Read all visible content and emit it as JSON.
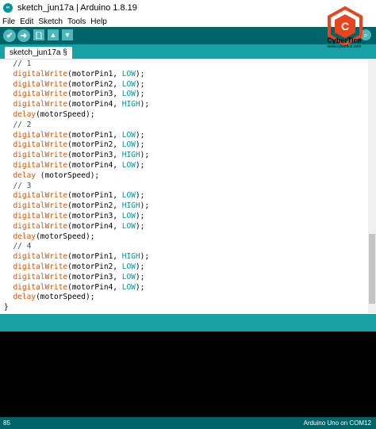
{
  "window": {
    "title": "sketch_jun17a | Arduino 1.8.19"
  },
  "menu": {
    "items": [
      "File",
      "Edit",
      "Sketch",
      "Tools",
      "Help"
    ]
  },
  "toolbar": {
    "buttons": [
      {
        "name": "verify",
        "icon": "check-icon"
      },
      {
        "name": "upload",
        "icon": "arrow-right-icon"
      },
      {
        "name": "new",
        "icon": "file-icon"
      },
      {
        "name": "open",
        "icon": "arrow-up-icon"
      },
      {
        "name": "save",
        "icon": "arrow-down-icon"
      }
    ],
    "serial_monitor_icon": "magnifier-icon"
  },
  "tabs": [
    {
      "label": "sketch_jun17a §"
    }
  ],
  "editor": {
    "lines": [
      {
        "indent": "  ",
        "parts": [
          {
            "t": "// 1",
            "c": "comment"
          }
        ]
      },
      {
        "indent": "  ",
        "parts": [
          {
            "t": "digitalWrite",
            "c": "fn"
          },
          {
            "t": "(motorPin1, ",
            "c": "plain"
          },
          {
            "t": "LOW",
            "c": "const"
          },
          {
            "t": ");",
            "c": "plain"
          }
        ]
      },
      {
        "indent": "  ",
        "parts": [
          {
            "t": "digitalWrite",
            "c": "fn"
          },
          {
            "t": "(motorPin2, ",
            "c": "plain"
          },
          {
            "t": "LOW",
            "c": "const"
          },
          {
            "t": ");",
            "c": "plain"
          }
        ]
      },
      {
        "indent": "  ",
        "parts": [
          {
            "t": "digitalWrite",
            "c": "fn"
          },
          {
            "t": "(motorPin3, ",
            "c": "plain"
          },
          {
            "t": "LOW",
            "c": "const"
          },
          {
            "t": ");",
            "c": "plain"
          }
        ]
      },
      {
        "indent": "  ",
        "parts": [
          {
            "t": "digitalWrite",
            "c": "fn"
          },
          {
            "t": "(motorPin4, ",
            "c": "plain"
          },
          {
            "t": "HIGH",
            "c": "const"
          },
          {
            "t": ");",
            "c": "plain"
          }
        ]
      },
      {
        "indent": "  ",
        "parts": [
          {
            "t": "delay",
            "c": "fn"
          },
          {
            "t": "(motorSpeed);",
            "c": "plain"
          }
        ]
      },
      {
        "indent": "  ",
        "parts": [
          {
            "t": "// 2",
            "c": "comment"
          }
        ]
      },
      {
        "indent": "  ",
        "parts": [
          {
            "t": "digitalWrite",
            "c": "fn"
          },
          {
            "t": "(motorPin1, ",
            "c": "plain"
          },
          {
            "t": "LOW",
            "c": "const"
          },
          {
            "t": ");",
            "c": "plain"
          }
        ]
      },
      {
        "indent": "  ",
        "parts": [
          {
            "t": "digitalWrite",
            "c": "fn"
          },
          {
            "t": "(motorPin2, ",
            "c": "plain"
          },
          {
            "t": "LOW",
            "c": "const"
          },
          {
            "t": ");",
            "c": "plain"
          }
        ]
      },
      {
        "indent": "  ",
        "parts": [
          {
            "t": "digitalWrite",
            "c": "fn"
          },
          {
            "t": "(motorPin3, ",
            "c": "plain"
          },
          {
            "t": "HIGH",
            "c": "const"
          },
          {
            "t": ");",
            "c": "plain"
          }
        ]
      },
      {
        "indent": "  ",
        "parts": [
          {
            "t": "digitalWrite",
            "c": "fn"
          },
          {
            "t": "(motorPin4, ",
            "c": "plain"
          },
          {
            "t": "LOW",
            "c": "const"
          },
          {
            "t": ");",
            "c": "plain"
          }
        ]
      },
      {
        "indent": "  ",
        "parts": [
          {
            "t": "delay",
            "c": "fn"
          },
          {
            "t": " (motorSpeed);",
            "c": "plain"
          }
        ]
      },
      {
        "indent": "  ",
        "parts": [
          {
            "t": "// 3",
            "c": "comment"
          }
        ]
      },
      {
        "indent": "  ",
        "parts": [
          {
            "t": "digitalWrite",
            "c": "fn"
          },
          {
            "t": "(motorPin1, ",
            "c": "plain"
          },
          {
            "t": "LOW",
            "c": "const"
          },
          {
            "t": ");",
            "c": "plain"
          }
        ]
      },
      {
        "indent": "  ",
        "parts": [
          {
            "t": "digitalWrite",
            "c": "fn"
          },
          {
            "t": "(motorPin2, ",
            "c": "plain"
          },
          {
            "t": "HIGH",
            "c": "const"
          },
          {
            "t": ");",
            "c": "plain"
          }
        ]
      },
      {
        "indent": "  ",
        "parts": [
          {
            "t": "digitalWrite",
            "c": "fn"
          },
          {
            "t": "(motorPin3, ",
            "c": "plain"
          },
          {
            "t": "LOW",
            "c": "const"
          },
          {
            "t": ");",
            "c": "plain"
          }
        ]
      },
      {
        "indent": "  ",
        "parts": [
          {
            "t": "digitalWrite",
            "c": "fn"
          },
          {
            "t": "(motorPin4, ",
            "c": "plain"
          },
          {
            "t": "LOW",
            "c": "const"
          },
          {
            "t": ");",
            "c": "plain"
          }
        ]
      },
      {
        "indent": "  ",
        "parts": [
          {
            "t": "delay",
            "c": "fn"
          },
          {
            "t": "(motorSpeed);",
            "c": "plain"
          }
        ]
      },
      {
        "indent": "  ",
        "parts": [
          {
            "t": "// 4",
            "c": "comment"
          }
        ]
      },
      {
        "indent": "  ",
        "parts": [
          {
            "t": "digitalWrite",
            "c": "fn"
          },
          {
            "t": "(motorPin1, ",
            "c": "plain"
          },
          {
            "t": "HIGH",
            "c": "const"
          },
          {
            "t": ");",
            "c": "plain"
          }
        ]
      },
      {
        "indent": "  ",
        "parts": [
          {
            "t": "digitalWrite",
            "c": "fn"
          },
          {
            "t": "(motorPin2, ",
            "c": "plain"
          },
          {
            "t": "LOW",
            "c": "const"
          },
          {
            "t": ");",
            "c": "plain"
          }
        ]
      },
      {
        "indent": "  ",
        "parts": [
          {
            "t": "digitalWrite",
            "c": "fn"
          },
          {
            "t": "(motorPin3, ",
            "c": "plain"
          },
          {
            "t": "LOW",
            "c": "const"
          },
          {
            "t": ");",
            "c": "plain"
          }
        ]
      },
      {
        "indent": "  ",
        "parts": [
          {
            "t": "digitalWrite",
            "c": "fn"
          },
          {
            "t": "(motorPin4, ",
            "c": "plain"
          },
          {
            "t": "LOW",
            "c": "const"
          },
          {
            "t": ");",
            "c": "plain"
          }
        ]
      },
      {
        "indent": "  ",
        "parts": [
          {
            "t": "delay",
            "c": "fn"
          },
          {
            "t": "(motorSpeed);",
            "c": "plain"
          }
        ]
      },
      {
        "indent": "",
        "parts": [
          {
            "t": "}",
            "c": "plain"
          }
        ]
      }
    ]
  },
  "status": {
    "line_number": "85",
    "board": "Arduino Uno on COM12"
  },
  "watermark": {
    "letter": "C",
    "name": "CyberTice",
    "url": "www.cybertice.com"
  },
  "colors": {
    "toolbar": "#006468",
    "tabbar": "#17a1a5",
    "button": "#4db7bb",
    "function": "#d35400",
    "constant": "#00979c",
    "logo": "#e8451e"
  }
}
